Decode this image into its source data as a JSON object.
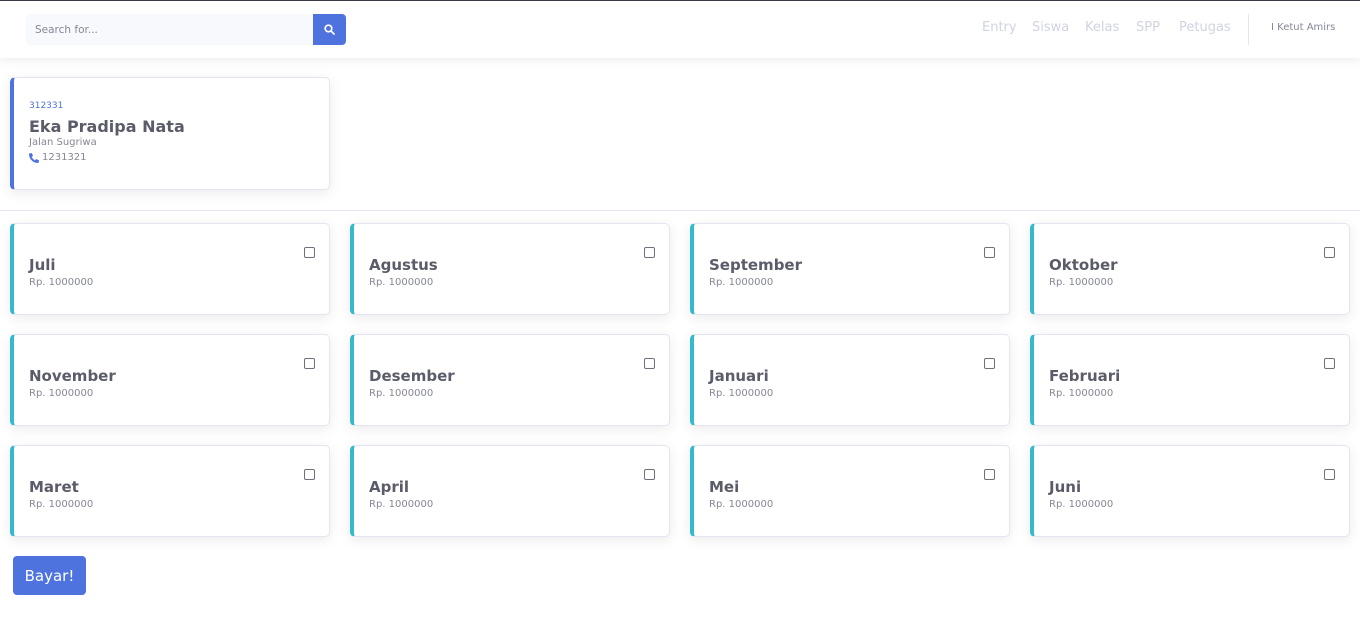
{
  "topbar": {
    "search": {
      "placeholder": "Search for...",
      "icon": "search-icon"
    },
    "nav": [
      {
        "label": "Entry"
      },
      {
        "label": "Siswa"
      },
      {
        "label": "Kelas"
      },
      {
        "label": "SPP"
      },
      {
        "label": "Petugas"
      }
    ],
    "user_name": "I Ketut Amirs"
  },
  "student": {
    "nisn": "312331",
    "name": "Eka Pradipa Nata",
    "address": "Jalan Sugriwa",
    "phone": "1231321"
  },
  "months": [
    {
      "name": "Juli",
      "price": "Rp. 1000000",
      "checked": false
    },
    {
      "name": "Agustus",
      "price": "Rp. 1000000",
      "checked": false
    },
    {
      "name": "September",
      "price": "Rp. 1000000",
      "checked": false
    },
    {
      "name": "Oktober",
      "price": "Rp. 1000000",
      "checked": false
    },
    {
      "name": "November",
      "price": "Rp. 1000000",
      "checked": false
    },
    {
      "name": "Desember",
      "price": "Rp. 1000000",
      "checked": false
    },
    {
      "name": "Januari",
      "price": "Rp. 1000000",
      "checked": false
    },
    {
      "name": "Februari",
      "price": "Rp. 1000000",
      "checked": false
    },
    {
      "name": "Maret",
      "price": "Rp. 1000000",
      "checked": false
    },
    {
      "name": "April",
      "price": "Rp. 1000000",
      "checked": false
    },
    {
      "name": "Mei",
      "price": "Rp. 1000000",
      "checked": false
    },
    {
      "name": "Juni",
      "price": "Rp. 1000000",
      "checked": false
    }
  ],
  "pay_button": {
    "label": "Bayar!"
  },
  "colors": {
    "primary": "#4e73df",
    "info": "#36b9cc",
    "text": "#5a5c69",
    "muted": "#858796",
    "nav": "#d1d3e2"
  }
}
